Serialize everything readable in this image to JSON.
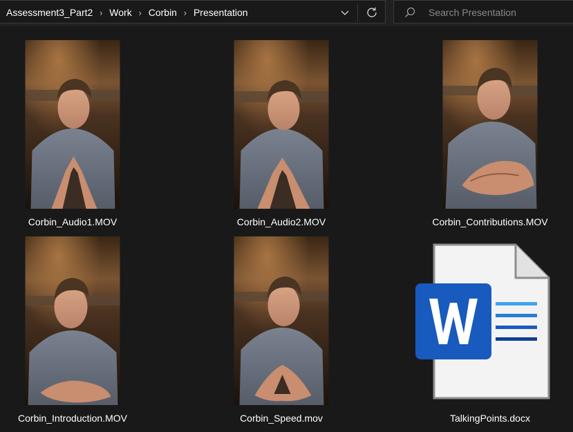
{
  "breadcrumb": {
    "items": [
      "Assessment3_Part2",
      "Work",
      "Corbin",
      "Presentation"
    ]
  },
  "search": {
    "placeholder": "Search Presentation"
  },
  "files": [
    {
      "name": "Corbin_Audio1.MOV",
      "kind": "video"
    },
    {
      "name": "Corbin_Audio2.MOV",
      "kind": "video"
    },
    {
      "name": "Corbin_Contributions.MOV",
      "kind": "video"
    },
    {
      "name": "Corbin_Introduction.MOV",
      "kind": "video"
    },
    {
      "name": "Corbin_Speed.mov",
      "kind": "video"
    },
    {
      "name": "TalkingPoints.docx",
      "kind": "word-document"
    }
  ],
  "colors": {
    "background": "#191919",
    "word_blue": "#185abd",
    "word_accent_light": "#41a5ee",
    "word_accent_mid": "#2b7cd3",
    "word_accent_dark": "#103f91"
  },
  "icons": {
    "dropdown": "chevron-down-icon",
    "refresh": "refresh-icon",
    "search": "search-icon",
    "separator": "chevron-right-icon",
    "document": "word-document-icon"
  }
}
